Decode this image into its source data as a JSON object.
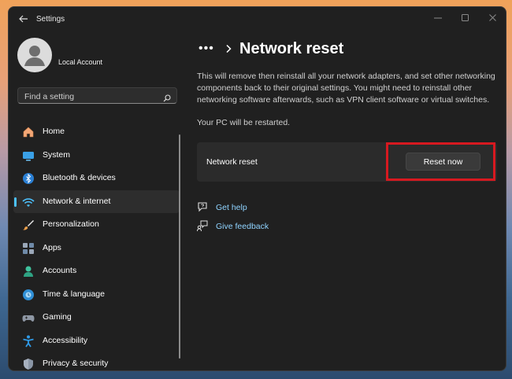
{
  "window": {
    "title": "Settings"
  },
  "account": {
    "name": "Local Account"
  },
  "search": {
    "placeholder": "Find a setting"
  },
  "sidebar": {
    "items": [
      {
        "label": "Home",
        "icon": "home-icon"
      },
      {
        "label": "System",
        "icon": "system-icon"
      },
      {
        "label": "Bluetooth & devices",
        "icon": "bluetooth-icon"
      },
      {
        "label": "Network & internet",
        "icon": "wifi-icon",
        "active": true
      },
      {
        "label": "Personalization",
        "icon": "brush-icon"
      },
      {
        "label": "Apps",
        "icon": "apps-icon"
      },
      {
        "label": "Accounts",
        "icon": "person-icon"
      },
      {
        "label": "Time & language",
        "icon": "globe-clock-icon"
      },
      {
        "label": "Gaming",
        "icon": "gamepad-icon"
      },
      {
        "label": "Accessibility",
        "icon": "accessibility-icon"
      },
      {
        "label": "Privacy & security",
        "icon": "shield-icon"
      }
    ]
  },
  "breadcrumb": {
    "ellipsis": "•••",
    "title": "Network reset"
  },
  "main": {
    "description": "This will remove then reinstall all your network adapters, and set other networking components back to their original settings. You might need to reinstall other networking software afterwards, such as VPN client software or virtual switches.",
    "restart_note": "Your PC will be restarted.",
    "card": {
      "label": "Network reset",
      "button": "Reset now"
    },
    "links": {
      "help": "Get help",
      "feedback": "Give feedback"
    }
  },
  "colors": {
    "accent": "#4cc2ff",
    "highlight": "#d71920",
    "link": "#8fd3ff",
    "background": "#202020"
  }
}
